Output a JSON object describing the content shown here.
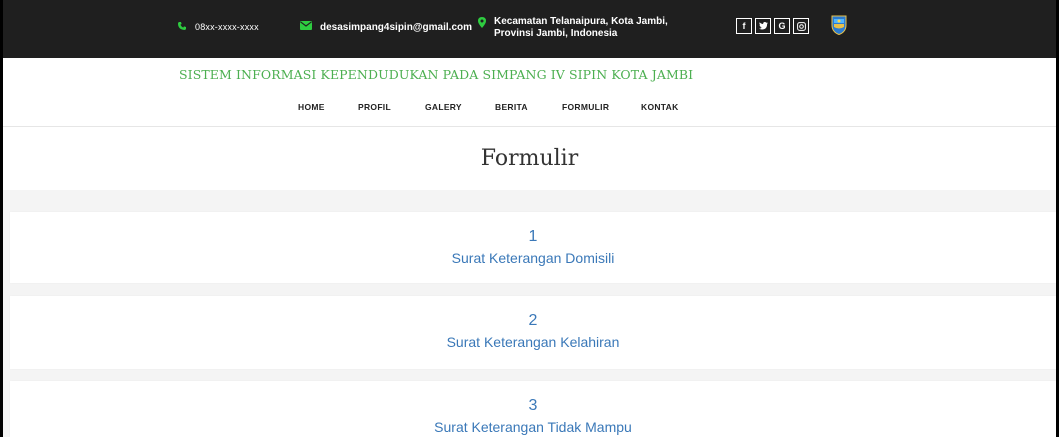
{
  "topbar": {
    "phone": "08xx-xxxx-xxxx",
    "email": "desasimpang4sipin@gmail.com",
    "address_line1": "Kecamatan Telanaipura, Kota Jambi,",
    "address_line2": "Provinsi Jambi, Indonesia",
    "social": [
      {
        "icon": "facebook-icon",
        "glyph": "f"
      },
      {
        "icon": "twitter-icon",
        "glyph": "🐦"
      },
      {
        "icon": "google-icon",
        "glyph": "G"
      },
      {
        "icon": "instagram-icon",
        "glyph": "◎"
      }
    ]
  },
  "header": {
    "site_title": "SISTEM INFORMASI KEPENDUDUKAN PADA SIMPANG IV SIPIN KOTA JAMBI",
    "nav": [
      "HOME",
      "PROFIL",
      "GALERY",
      "BERITA",
      "FORMULIR",
      "KONTAK"
    ]
  },
  "main": {
    "heading": "Formulir",
    "forms": [
      {
        "number": "1",
        "title": "Surat Keterangan Domisili"
      },
      {
        "number": "2",
        "title": "Surat Keterangan Kelahiran"
      },
      {
        "number": "3",
        "title": "Surat Keterangan Tidak Mampu"
      }
    ]
  },
  "colors": {
    "topbar_bg": "#1f1f1f",
    "title_green": "#4caf50",
    "link_blue": "#3a78b8",
    "icon_green": "#2ecc40"
  }
}
